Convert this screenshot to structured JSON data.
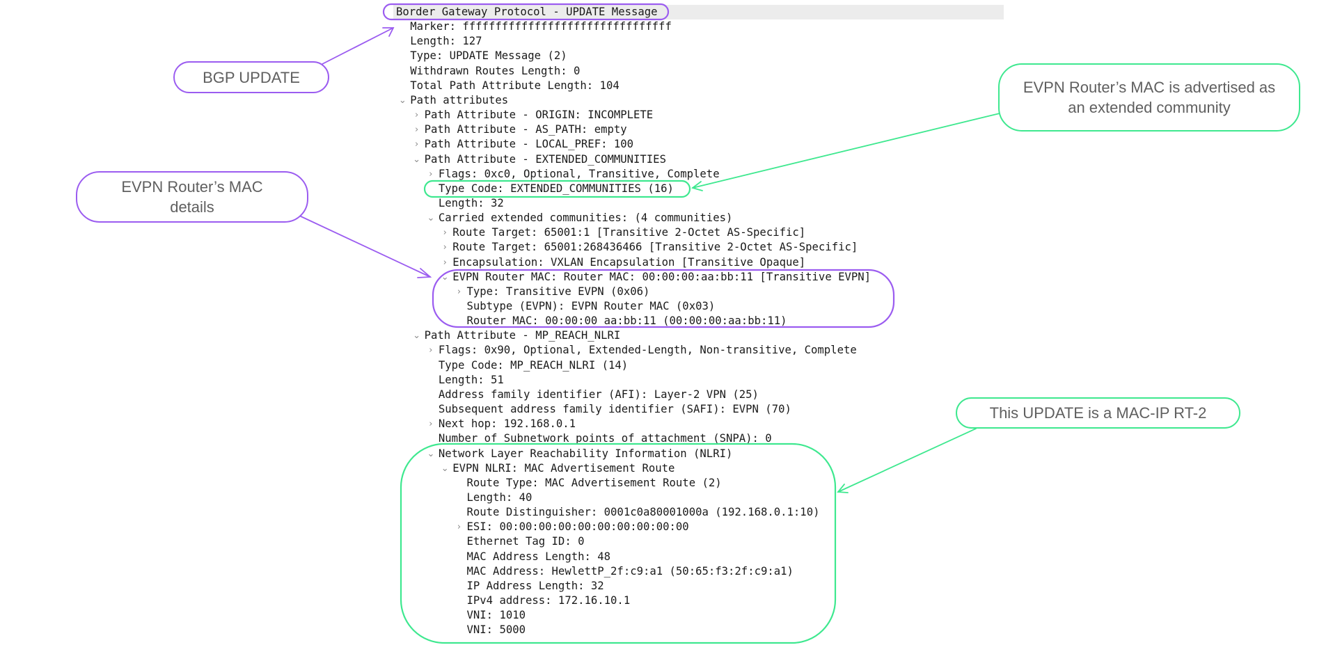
{
  "colors": {
    "purple": "#9b5cf0",
    "green": "#3ee88f",
    "highlight": "#ececec",
    "chevron": "#8a8a8a",
    "text": "#1a1a1a"
  },
  "icons": {
    "expanded": "chevron-down-icon",
    "collapsed": "chevron-right-icon"
  },
  "tree": [
    {
      "text": "Border Gateway Protocol - UPDATE Message",
      "level": 0,
      "toggle": "none",
      "highlight": true
    },
    {
      "text": "Marker: ffffffffffffffffffffffffffffffff",
      "level": 1,
      "toggle": "none"
    },
    {
      "text": "Length: 127",
      "level": 1,
      "toggle": "none"
    },
    {
      "text": "Type: UPDATE Message (2)",
      "level": 1,
      "toggle": "none"
    },
    {
      "text": "Withdrawn Routes Length: 0",
      "level": 1,
      "toggle": "none"
    },
    {
      "text": "Total Path Attribute Length: 104",
      "level": 1,
      "toggle": "none"
    },
    {
      "text": "Path attributes",
      "level": 1,
      "toggle": "expanded"
    },
    {
      "text": "Path Attribute - ORIGIN: INCOMPLETE",
      "level": 2,
      "toggle": "collapsed"
    },
    {
      "text": "Path Attribute - AS_PATH: empty",
      "level": 2,
      "toggle": "collapsed"
    },
    {
      "text": "Path Attribute - LOCAL_PREF: 100",
      "level": 2,
      "toggle": "collapsed"
    },
    {
      "text": "Path Attribute - EXTENDED_COMMUNITIES",
      "level": 2,
      "toggle": "expanded"
    },
    {
      "text": "Flags: 0xc0, Optional, Transitive, Complete",
      "level": 3,
      "toggle": "collapsed"
    },
    {
      "text": "Type Code: EXTENDED_COMMUNITIES (16)",
      "level": 3,
      "toggle": "none"
    },
    {
      "text": "Length: 32",
      "level": 3,
      "toggle": "none"
    },
    {
      "text": "Carried extended communities: (4 communities)",
      "level": 3,
      "toggle": "expanded"
    },
    {
      "text": "Route Target: 65001:1 [Transitive 2-Octet AS-Specific]",
      "level": 4,
      "toggle": "collapsed"
    },
    {
      "text": "Route Target: 65001:268436466 [Transitive 2-Octet AS-Specific]",
      "level": 4,
      "toggle": "collapsed"
    },
    {
      "text": "Encapsulation: VXLAN Encapsulation [Transitive Opaque]",
      "level": 4,
      "toggle": "collapsed"
    },
    {
      "text": "EVPN Router MAC: Router MAC: 00:00:00:aa:bb:11 [Transitive EVPN]",
      "level": 4,
      "toggle": "expanded"
    },
    {
      "text": "Type: Transitive EVPN (0x06)",
      "level": 5,
      "toggle": "collapsed"
    },
    {
      "text": "Subtype (EVPN): EVPN Router MAC (0x03)",
      "level": 5,
      "toggle": "none"
    },
    {
      "text": "Router MAC: 00:00:00_aa:bb:11 (00:00:00:aa:bb:11)",
      "level": 5,
      "toggle": "none"
    },
    {
      "text": "Path Attribute - MP_REACH_NLRI",
      "level": 2,
      "toggle": "expanded"
    },
    {
      "text": "Flags: 0x90, Optional, Extended-Length, Non-transitive, Complete",
      "level": 3,
      "toggle": "collapsed"
    },
    {
      "text": "Type Code: MP_REACH_NLRI (14)",
      "level": 3,
      "toggle": "none"
    },
    {
      "text": "Length: 51",
      "level": 3,
      "toggle": "none"
    },
    {
      "text": "Address family identifier (AFI): Layer-2 VPN (25)",
      "level": 3,
      "toggle": "none"
    },
    {
      "text": "Subsequent address family identifier (SAFI): EVPN (70)",
      "level": 3,
      "toggle": "none"
    },
    {
      "text": "Next hop: 192.168.0.1",
      "level": 3,
      "toggle": "collapsed"
    },
    {
      "text": "Number of Subnetwork points of attachment (SNPA): 0",
      "level": 3,
      "toggle": "none"
    },
    {
      "text": "Network Layer Reachability Information (NLRI)",
      "level": 3,
      "toggle": "expanded"
    },
    {
      "text": "EVPN NLRI: MAC Advertisement Route",
      "level": 4,
      "toggle": "expanded"
    },
    {
      "text": "Route Type: MAC Advertisement Route (2)",
      "level": 5,
      "toggle": "none"
    },
    {
      "text": "Length: 40",
      "level": 5,
      "toggle": "none"
    },
    {
      "text": "Route Distinguisher: 0001c0a80001000a (192.168.0.1:10)",
      "level": 5,
      "toggle": "none"
    },
    {
      "text": "ESI: 00:00:00:00:00:00:00:00:00:00",
      "level": 5,
      "toggle": "collapsed"
    },
    {
      "text": "Ethernet Tag ID: 0",
      "level": 5,
      "toggle": "none"
    },
    {
      "text": "MAC Address Length: 48",
      "level": 5,
      "toggle": "none"
    },
    {
      "text": "MAC Address: HewlettP_2f:c9:a1 (50:65:f3:2f:c9:a1)",
      "level": 5,
      "toggle": "none"
    },
    {
      "text": "IP Address Length: 32",
      "level": 5,
      "toggle": "none"
    },
    {
      "text": "IPv4 address: 172.16.10.1",
      "level": 5,
      "toggle": "none"
    },
    {
      "text": "VNI: 1010",
      "level": 5,
      "toggle": "none"
    },
    {
      "text": "VNI: 5000",
      "level": 5,
      "toggle": "none"
    }
  ],
  "callouts": {
    "bgp_update": {
      "text": "BGP UPDATE",
      "color": "purple"
    },
    "router_mac_details": {
      "line1": "EVPN Router’s MAC",
      "line2": "details",
      "color": "purple"
    },
    "router_mac_ext_community": {
      "line1": "EVPN Router’s MAC is advertised as",
      "line2": "an extended community",
      "color": "green"
    },
    "mac_ip_rt2": {
      "text": "This UPDATE is a MAC-IP RT-2",
      "color": "green"
    }
  }
}
